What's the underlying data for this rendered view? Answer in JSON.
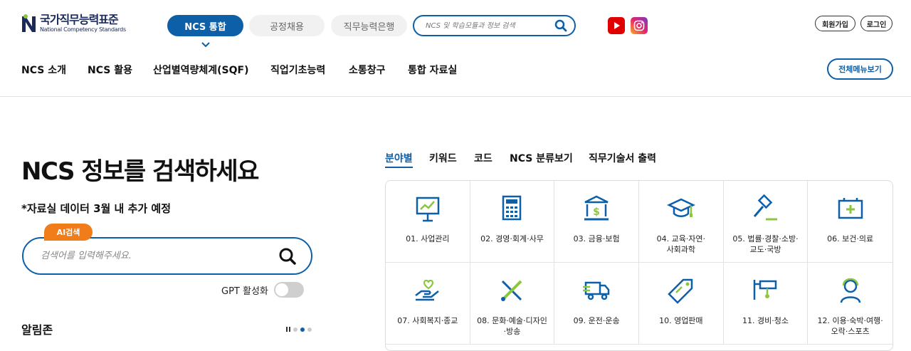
{
  "header": {
    "logo_kr": "국가직무능력표준",
    "logo_en": "National Competency Standards",
    "pills": [
      "NCS 통합",
      "공정채용",
      "직무능력은행"
    ],
    "search_placeholder": "NCS 및 학습모듈과 정보 검색",
    "auth": {
      "signup": "회원가입",
      "login": "로그인"
    },
    "nav": [
      "NCS 소개",
      "NCS 활용",
      "산업별역량체계(SQF)",
      "직업기초능력",
      "소통창구",
      "통합 자료실"
    ],
    "all_menu": "전체메뉴보기"
  },
  "left": {
    "title": "NCS 정보를 검색하세요",
    "notice": "*자료실 데이터 3월 내 추가 예정",
    "ai_badge": "AI검색",
    "search_placeholder": "검색어를 입력해주세요.",
    "gpt_label": "GPT 활성화",
    "alim": "알림존"
  },
  "tabs": [
    "분야별",
    "키워드",
    "코드",
    "NCS 분류보기",
    "직무기술서 출력"
  ],
  "categories": [
    {
      "label": "01. 사업관리",
      "icon": "presentation-icon"
    },
    {
      "label": "02. 경영·회계·사무",
      "icon": "calculator-icon"
    },
    {
      "label": "03. 금융·보험",
      "icon": "bank-icon"
    },
    {
      "label": "04. 교육·자연·\n사회과학",
      "icon": "graduation-cap-icon"
    },
    {
      "label": "05. 법률·경찰·소방·\n교도·국방",
      "icon": "gavel-icon"
    },
    {
      "label": "06. 보건·의료",
      "icon": "medical-kit-icon"
    },
    {
      "label": "07. 사회복지·종교",
      "icon": "heart-hand-icon"
    },
    {
      "label": "08. 문화·예술·디자인\n·방송",
      "icon": "brush-icon"
    },
    {
      "label": "09. 운전·운송",
      "icon": "truck-icon"
    },
    {
      "label": "10. 영업판매",
      "icon": "price-tag-icon"
    },
    {
      "label": "11. 경비·청소",
      "icon": "cctv-icon"
    },
    {
      "label": "12. 이용·숙박·여행·\n오락·스포츠",
      "icon": "service-person-icon"
    }
  ],
  "colors": {
    "primary": "#0d5fa8",
    "accent": "#8cc63f",
    "orange": "#f07d1a"
  }
}
